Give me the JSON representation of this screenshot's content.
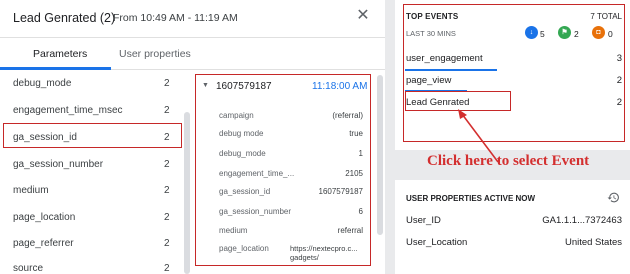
{
  "dialog": {
    "title": "Lead Genrated (2)",
    "time_range": "From 10:49 AM - 11:19 AM",
    "close_icon": "close-icon"
  },
  "tabs": [
    {
      "label": "Parameters",
      "active": true
    },
    {
      "label": "User properties",
      "active": false
    }
  ],
  "parameters": [
    {
      "name": "debug_mode",
      "count": "2"
    },
    {
      "name": "engagement_time_msec",
      "count": "2"
    },
    {
      "name": "ga_session_id",
      "count": "2",
      "highlighted": true
    },
    {
      "name": "ga_session_number",
      "count": "2"
    },
    {
      "name": "medium",
      "count": "2"
    },
    {
      "name": "page_location",
      "count": "2"
    },
    {
      "name": "page_referrer",
      "count": "2"
    },
    {
      "name": "source",
      "count": "2"
    }
  ],
  "detail": {
    "id": "1607579187",
    "time": "11:18:00 AM",
    "rows": [
      {
        "key": "campaign",
        "value": "(referral)"
      },
      {
        "key": "debug mode",
        "value": "true"
      },
      {
        "key": "debug_mode",
        "value": "1"
      },
      {
        "key": "engagement_time_...",
        "value": "2105"
      },
      {
        "key": "ga_session_id",
        "value": "1607579187"
      },
      {
        "key": "ga_session_number",
        "value": "6"
      },
      {
        "key": "medium",
        "value": "referral"
      }
    ],
    "page_location_key": "page_location",
    "page_location_value": "https://nextecpro.c... gadgets/"
  },
  "top_events": {
    "title": "TOP EVENTS",
    "total": "7 TOTAL",
    "subtitle": "LAST 30 MINS",
    "badges": [
      {
        "icon": "download-icon",
        "color": "#1a73e8",
        "count": "5"
      },
      {
        "icon": "flag-icon",
        "color": "#34a853",
        "count": "2"
      },
      {
        "icon": "cart-icon",
        "color": "#e8710a",
        "count": "0"
      }
    ],
    "events": [
      {
        "name": "user_engagement",
        "count": "3"
      },
      {
        "name": "page_view",
        "count": "2"
      },
      {
        "name": "Lead Genrated",
        "count": "2"
      }
    ]
  },
  "annotation": {
    "text": "Click here to select Event",
    "color": "#d32f2f"
  },
  "user_properties": {
    "title": "USER PROPERTIES ACTIVE NOW",
    "history_icon": "history-icon",
    "rows": [
      {
        "key": "User_ID",
        "value": "GA1.1.1...7372463"
      },
      {
        "key": "User_Location",
        "value": "United States"
      }
    ]
  }
}
